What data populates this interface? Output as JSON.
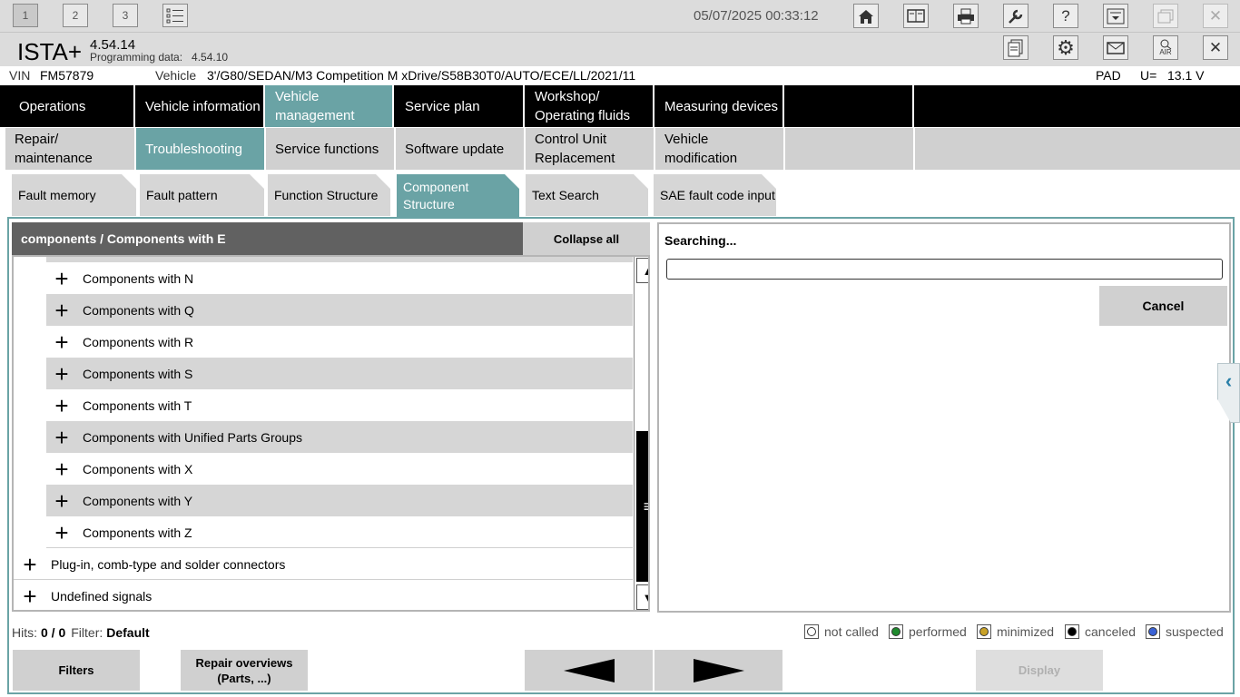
{
  "top_bar": {
    "session_tabs": [
      "1",
      "2",
      "3"
    ],
    "datetime": "05/07/2025 00:33:12",
    "icons": [
      "home-icon",
      "compare-icon",
      "print-icon",
      "wrench-icon",
      "help-icon",
      "download-icon",
      "restore-window-icon",
      "close-icon"
    ]
  },
  "app": {
    "name": "ISTA+",
    "version": "4.54.14",
    "programming_data_label": "Programming data:",
    "programming_data_value": "4.54.10",
    "icons": [
      "document-icon",
      "gear-icon",
      "mail-icon",
      "air-icon",
      "exit-icon"
    ],
    "air_label": "AIR"
  },
  "vehicle": {
    "vin_label": "VIN",
    "vin": "FM57879",
    "vehicle_label": "Vehicle",
    "vehicle_value": "3'/G80/SEDAN/M3 Competition M xDrive/S58B30T0/AUTO/ECE/LL/2021/11",
    "pad_label": "PAD",
    "voltage_label": "U=",
    "voltage_value": "13.1 V"
  },
  "main_nav": [
    {
      "label": "Operations",
      "active": false
    },
    {
      "label": "Vehicle information",
      "active": false
    },
    {
      "label": "Vehicle management",
      "active": true
    },
    {
      "label": "Service plan",
      "active": false
    },
    {
      "label": "Workshop/ Operating fluids",
      "active": false
    },
    {
      "label": "Measuring devices",
      "active": false
    }
  ],
  "sub_nav": [
    {
      "label": "Repair/ maintenance",
      "active": false
    },
    {
      "label": "Troubleshooting",
      "active": true
    },
    {
      "label": "Service functions",
      "active": false
    },
    {
      "label": "Software update",
      "active": false
    },
    {
      "label": "Control Unit Replacement",
      "active": false
    },
    {
      "label": "Vehicle modification",
      "active": false
    }
  ],
  "sub_sub_nav": [
    {
      "label": "Fault memory",
      "active": false
    },
    {
      "label": "Fault pattern",
      "active": false
    },
    {
      "label": "Function Structure",
      "active": false
    },
    {
      "label": "Component Structure",
      "active": true
    },
    {
      "label": "Text Search",
      "active": false
    },
    {
      "label": "SAE fault code input",
      "active": false
    }
  ],
  "left_panel": {
    "header": "components / Components with E",
    "collapse_label": "Collapse all",
    "rows": [
      {
        "label": "Components with N",
        "level": 2
      },
      {
        "label": "Components with Q",
        "level": 2
      },
      {
        "label": "Components with R",
        "level": 2
      },
      {
        "label": "Components with S",
        "level": 2
      },
      {
        "label": "Components with T",
        "level": 2
      },
      {
        "label": "Components with Unified Parts Groups",
        "level": 2
      },
      {
        "label": "Components with X",
        "level": 2
      },
      {
        "label": "Components with Y",
        "level": 2
      },
      {
        "label": "Components with Z",
        "level": 2
      },
      {
        "label": "Plug-in, comb-type and solder connectors",
        "level": 1
      },
      {
        "label": "Undefined signals",
        "level": 1
      }
    ]
  },
  "right_panel": {
    "status": "Searching...",
    "cancel_label": "Cancel"
  },
  "status": {
    "hits_label": "Hits:",
    "hits_value": "0 / 0",
    "filter_label": "Filter:",
    "filter_value": "Default"
  },
  "legend": [
    {
      "label": "not called",
      "color": "#ffffff"
    },
    {
      "label": "performed",
      "color": "#1f8a2e"
    },
    {
      "label": "minimized",
      "color": "#c9a227"
    },
    {
      "label": "canceled",
      "color": "#000000"
    },
    {
      "label": "suspected",
      "color": "#3a62d6"
    }
  ],
  "bottom_buttons": {
    "filters": "Filters",
    "repair_overviews_line1": "Repair overviews",
    "repair_overviews_line2": "(Parts, ...)",
    "display": "Display"
  },
  "colors": {
    "accent": "#6aa3a5",
    "nav_bg": "#000000",
    "tab_bg": "#d0d0d0"
  }
}
